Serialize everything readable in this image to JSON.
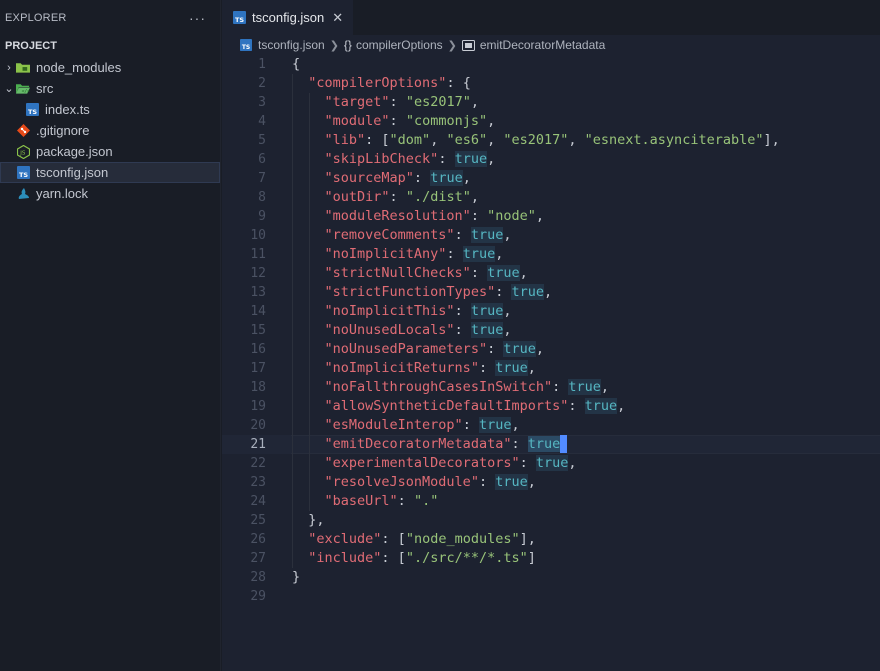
{
  "explorer": {
    "title": "EXPLORER",
    "more": "···",
    "section": "PROJECT",
    "items": [
      {
        "label": "node_modules",
        "twisty": "›",
        "depth": 0
      },
      {
        "label": "src",
        "twisty": "⌄",
        "depth": 0
      },
      {
        "label": "index.ts",
        "depth": 1
      },
      {
        "label": ".gitignore",
        "depth": 0
      },
      {
        "label": "package.json",
        "depth": 0
      },
      {
        "label": "tsconfig.json",
        "depth": 0,
        "selected": true
      },
      {
        "label": "yarn.lock",
        "depth": 0
      }
    ]
  },
  "tab": {
    "title": "tsconfig.json",
    "close": "✕",
    "icon": "TS"
  },
  "breadcrumb": {
    "file": "tsconfig.json",
    "obj": "compilerOptions",
    "obj_icon": "{}",
    "prop": "emitDecoratorMetadata"
  },
  "colors": {
    "key": "#e06c75",
    "string": "#98c379",
    "boolean": "#56b6c2",
    "accent": "#528bff",
    "background": "#1d2230"
  },
  "code": {
    "current_line": 21,
    "lines": [
      {
        "n": "1",
        "parts": [
          [
            "p",
            "{"
          ]
        ]
      },
      {
        "n": "2",
        "parts": [
          [
            "p",
            "  "
          ],
          [
            "k",
            "\"compilerOptions\""
          ],
          [
            "p",
            ": {"
          ]
        ]
      },
      {
        "n": "3",
        "parts": [
          [
            "p",
            "    "
          ],
          [
            "k",
            "\"target\""
          ],
          [
            "p",
            ": "
          ],
          [
            "s",
            "\"es2017\""
          ],
          [
            "p",
            ","
          ]
        ]
      },
      {
        "n": "4",
        "parts": [
          [
            "p",
            "    "
          ],
          [
            "k",
            "\"module\""
          ],
          [
            "p",
            ": "
          ],
          [
            "s",
            "\"commonjs\""
          ],
          [
            "p",
            ","
          ]
        ]
      },
      {
        "n": "5",
        "parts": [
          [
            "p",
            "    "
          ],
          [
            "k",
            "\"lib\""
          ],
          [
            "p",
            ": ["
          ],
          [
            "s",
            "\"dom\""
          ],
          [
            "p",
            ", "
          ],
          [
            "s",
            "\"es6\""
          ],
          [
            "p",
            ", "
          ],
          [
            "s",
            "\"es2017\""
          ],
          [
            "p",
            ", "
          ],
          [
            "s",
            "\"esnext.asynciterable\""
          ],
          [
            "p",
            "],"
          ]
        ]
      },
      {
        "n": "6",
        "parts": [
          [
            "p",
            "    "
          ],
          [
            "k",
            "\"skipLibCheck\""
          ],
          [
            "p",
            ": "
          ],
          [
            "b",
            "true"
          ],
          [
            "p",
            ","
          ]
        ]
      },
      {
        "n": "7",
        "parts": [
          [
            "p",
            "    "
          ],
          [
            "k",
            "\"sourceMap\""
          ],
          [
            "p",
            ": "
          ],
          [
            "b",
            "true"
          ],
          [
            "p",
            ","
          ]
        ]
      },
      {
        "n": "8",
        "parts": [
          [
            "p",
            "    "
          ],
          [
            "k",
            "\"outDir\""
          ],
          [
            "p",
            ": "
          ],
          [
            "s",
            "\"./dist\""
          ],
          [
            "p",
            ","
          ]
        ]
      },
      {
        "n": "9",
        "parts": [
          [
            "p",
            "    "
          ],
          [
            "k",
            "\"moduleResolution\""
          ],
          [
            "p",
            ": "
          ],
          [
            "s",
            "\"node\""
          ],
          [
            "p",
            ","
          ]
        ]
      },
      {
        "n": "10",
        "parts": [
          [
            "p",
            "    "
          ],
          [
            "k",
            "\"removeComments\""
          ],
          [
            "p",
            ": "
          ],
          [
            "b",
            "true"
          ],
          [
            "p",
            ","
          ]
        ]
      },
      {
        "n": "11",
        "parts": [
          [
            "p",
            "    "
          ],
          [
            "k",
            "\"noImplicitAny\""
          ],
          [
            "p",
            ": "
          ],
          [
            "b",
            "true"
          ],
          [
            "p",
            ","
          ]
        ]
      },
      {
        "n": "12",
        "parts": [
          [
            "p",
            "    "
          ],
          [
            "k",
            "\"strictNullChecks\""
          ],
          [
            "p",
            ": "
          ],
          [
            "b",
            "true"
          ],
          [
            "p",
            ","
          ]
        ]
      },
      {
        "n": "13",
        "parts": [
          [
            "p",
            "    "
          ],
          [
            "k",
            "\"strictFunctionTypes\""
          ],
          [
            "p",
            ": "
          ],
          [
            "b",
            "true"
          ],
          [
            "p",
            ","
          ]
        ]
      },
      {
        "n": "14",
        "parts": [
          [
            "p",
            "    "
          ],
          [
            "k",
            "\"noImplicitThis\""
          ],
          [
            "p",
            ": "
          ],
          [
            "b",
            "true"
          ],
          [
            "p",
            ","
          ]
        ]
      },
      {
        "n": "15",
        "parts": [
          [
            "p",
            "    "
          ],
          [
            "k",
            "\"noUnusedLocals\""
          ],
          [
            "p",
            ": "
          ],
          [
            "b",
            "true"
          ],
          [
            "p",
            ","
          ]
        ]
      },
      {
        "n": "16",
        "parts": [
          [
            "p",
            "    "
          ],
          [
            "k",
            "\"noUnusedParameters\""
          ],
          [
            "p",
            ": "
          ],
          [
            "b",
            "true"
          ],
          [
            "p",
            ","
          ]
        ]
      },
      {
        "n": "17",
        "parts": [
          [
            "p",
            "    "
          ],
          [
            "k",
            "\"noImplicitReturns\""
          ],
          [
            "p",
            ": "
          ],
          [
            "b",
            "true"
          ],
          [
            "p",
            ","
          ]
        ]
      },
      {
        "n": "18",
        "parts": [
          [
            "p",
            "    "
          ],
          [
            "k",
            "\"noFallthroughCasesInSwitch\""
          ],
          [
            "p",
            ": "
          ],
          [
            "b",
            "true"
          ],
          [
            "p",
            ","
          ]
        ]
      },
      {
        "n": "19",
        "parts": [
          [
            "p",
            "    "
          ],
          [
            "k",
            "\"allowSyntheticDefaultImports\""
          ],
          [
            "p",
            ": "
          ],
          [
            "b",
            "true"
          ],
          [
            "p",
            ","
          ]
        ]
      },
      {
        "n": "20",
        "parts": [
          [
            "p",
            "    "
          ],
          [
            "k",
            "\"esModuleInterop\""
          ],
          [
            "p",
            ": "
          ],
          [
            "b",
            "true"
          ],
          [
            "p",
            ","
          ]
        ]
      },
      {
        "n": "21",
        "parts": [
          [
            "p",
            "    "
          ],
          [
            "k",
            "\"emitDecoratorMetadata\""
          ],
          [
            "p",
            ": "
          ],
          [
            "bc",
            "true"
          ]
        ]
      },
      {
        "n": "22",
        "parts": [
          [
            "p",
            "    "
          ],
          [
            "k",
            "\"experimentalDecorators\""
          ],
          [
            "p",
            ": "
          ],
          [
            "b",
            "true"
          ],
          [
            "p",
            ","
          ]
        ]
      },
      {
        "n": "23",
        "parts": [
          [
            "p",
            "    "
          ],
          [
            "k",
            "\"resolveJsonModule\""
          ],
          [
            "p",
            ": "
          ],
          [
            "b",
            "true"
          ],
          [
            "p",
            ","
          ]
        ]
      },
      {
        "n": "24",
        "parts": [
          [
            "p",
            "    "
          ],
          [
            "k",
            "\"baseUrl\""
          ],
          [
            "p",
            ": "
          ],
          [
            "s",
            "\".\""
          ]
        ]
      },
      {
        "n": "25",
        "parts": [
          [
            "p",
            "  },"
          ]
        ]
      },
      {
        "n": "26",
        "parts": [
          [
            "p",
            "  "
          ],
          [
            "k",
            "\"exclude\""
          ],
          [
            "p",
            ": ["
          ],
          [
            "s",
            "\"node_modules\""
          ],
          [
            "p",
            "],"
          ]
        ]
      },
      {
        "n": "27",
        "parts": [
          [
            "p",
            "  "
          ],
          [
            "k",
            "\"include\""
          ],
          [
            "p",
            ": ["
          ],
          [
            "s",
            "\"./src/**/*.ts\""
          ],
          [
            "p",
            "]"
          ]
        ]
      },
      {
        "n": "28",
        "parts": [
          [
            "p",
            "}"
          ]
        ]
      },
      {
        "n": "29",
        "parts": []
      }
    ]
  }
}
